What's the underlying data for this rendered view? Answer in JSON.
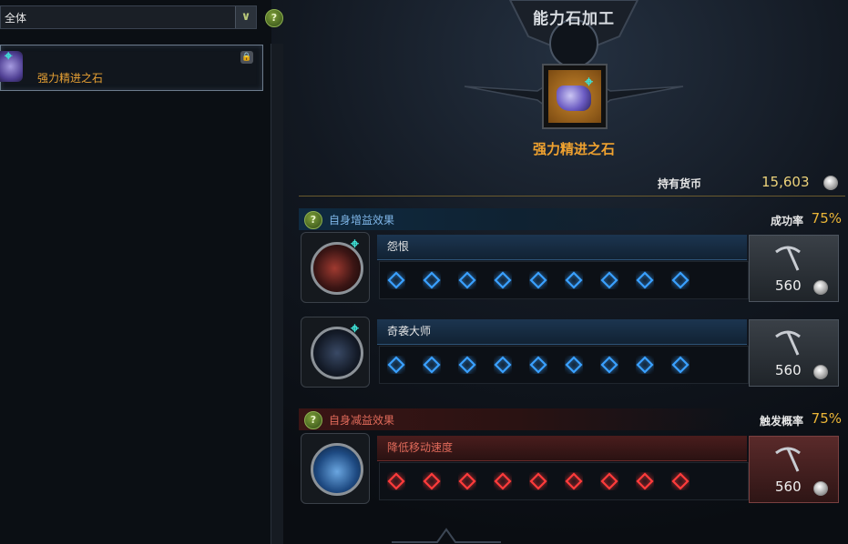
{
  "filter": {
    "value": "全体",
    "dropdown_icon": "chevron-down-icon",
    "help": "?"
  },
  "item_list": [
    {
      "name": "强力精进之石",
      "color": "#e8a134"
    }
  ],
  "panel": {
    "title": "能力石加工",
    "stone_name": "强力精进之石",
    "currency_label": "持有货币",
    "currency_value": "15,603"
  },
  "buff_section": {
    "label": "自身增益效果",
    "rate_label": "成功率",
    "rate_value": "75%",
    "help": "?"
  },
  "debuff_section": {
    "label": "自身减益效果",
    "rate_label": "触发概率",
    "rate_value": "75%",
    "help": "?"
  },
  "engravings": [
    {
      "name": "怨恨",
      "type": "buff",
      "slots": 9,
      "cost": "560",
      "slot_color": "#3aa0ff"
    },
    {
      "name": "奇袭大师",
      "type": "buff",
      "slots": 9,
      "cost": "560",
      "slot_color": "#3aa0ff"
    },
    {
      "name": "降低移动速度",
      "type": "debuff",
      "slots": 9,
      "cost": "560",
      "slot_color": "#ff3b3b"
    }
  ],
  "colors": {
    "accent_gold": "#ecb637",
    "buff_blue": "#3aa0ff",
    "debuff_red": "#ff3b3b"
  }
}
